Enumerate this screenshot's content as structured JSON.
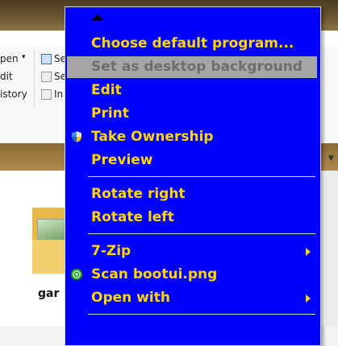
{
  "explorer": {
    "ribbon": {
      "open_label": "pen",
      "edit_label": "dit",
      "history_label": "istory",
      "select1_label": "Se",
      "select2_label": "Se",
      "invert_label": "In"
    },
    "file": {
      "name": "gar"
    }
  },
  "context_menu": {
    "items": {
      "choose_default_program": "Choose default program...",
      "set_as_desktop_background": "Set as desktop background",
      "edit": "Edit",
      "print": "Print",
      "take_ownership": "Take Ownership",
      "preview": "Preview",
      "rotate_right": "Rotate right",
      "rotate_left": "Rotate left",
      "seven_zip": "7-Zip",
      "scan": "Scan bootui.png",
      "open_with": "Open with"
    },
    "icons": {
      "take_ownership": "uac-shield-icon",
      "scan": "antivirus-scan-icon",
      "scroll_up": "scroll-up-arrow-icon",
      "submenu": "submenu-arrow-icon"
    },
    "colors": {
      "background": "#0000ff",
      "text": "#ffd700",
      "disabled_background": "#a6a6a6",
      "disabled_text": "#6e6e6e",
      "separator": "#d9d9d9"
    }
  }
}
